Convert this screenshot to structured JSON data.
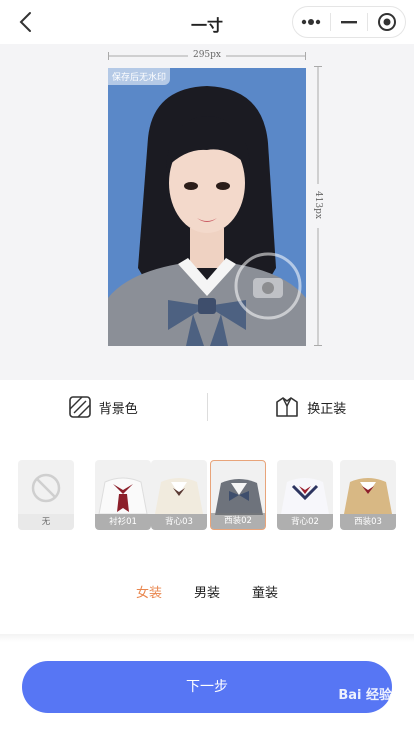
{
  "header": {
    "title": "一寸"
  },
  "preview": {
    "width_label": "295px",
    "height_label": "413px",
    "watermark_tag": "保存后无水印"
  },
  "tools": [
    {
      "label": "背景色",
      "icon": "background-color-icon"
    },
    {
      "label": "换正装",
      "icon": "suit-box-icon"
    }
  ],
  "outfits": [
    {
      "label": "无"
    },
    {
      "label": "衬衫01"
    },
    {
      "label": "背心03"
    },
    {
      "label": "西装02",
      "selected": true
    },
    {
      "label": "背心02"
    },
    {
      "label": "西装03"
    }
  ],
  "tabs": [
    {
      "label": "女装",
      "active": true
    },
    {
      "label": "男装"
    },
    {
      "label": "童装"
    }
  ],
  "footer": {
    "next_label": "下一步",
    "watermark": "Bai 经验"
  },
  "colors": {
    "accent": "#5776f4",
    "active_tab": "#e9874f",
    "photo_bg": "#5a88c8"
  }
}
